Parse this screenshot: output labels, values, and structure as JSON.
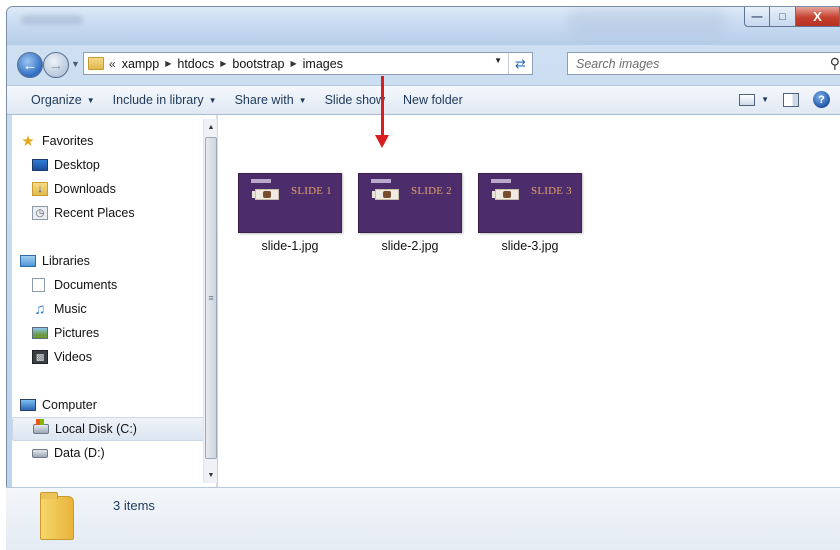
{
  "window": {
    "caption_buttons": {
      "minimize_icon": "minimize-icon",
      "maximize_icon": "maximize-icon",
      "close_label": "X"
    }
  },
  "address": {
    "overflow": "«",
    "crumbs": [
      "xampp",
      "htdocs",
      "bootstrap",
      "images"
    ],
    "refresh_icon": "refresh-icon"
  },
  "search": {
    "placeholder": "Search images"
  },
  "toolbar": {
    "organize": "Organize",
    "include_in_library": "Include in library",
    "share_with": "Share with",
    "slide_show": "Slide show",
    "new_folder": "New folder"
  },
  "sidebar": {
    "favorites": {
      "label": "Favorites",
      "items": [
        "Desktop",
        "Downloads",
        "Recent Places"
      ]
    },
    "libraries": {
      "label": "Libraries",
      "items": [
        "Documents",
        "Music",
        "Pictures",
        "Videos"
      ]
    },
    "computer": {
      "label": "Computer",
      "items": [
        "Local Disk (C:)",
        "Data (D:)"
      ],
      "selected": "Local Disk (C:)"
    }
  },
  "files": [
    {
      "name": "slide-1.jpg",
      "thumb_text": "SLIDE 1"
    },
    {
      "name": "slide-2.jpg",
      "thumb_text": "SLIDE 2"
    },
    {
      "name": "slide-3.jpg",
      "thumb_text": "SLIDE 3"
    }
  ],
  "status": {
    "item_count": "3 items"
  },
  "colors": {
    "annotation_arrow": "#d81e1e",
    "thumb_bg": "#4c2c6a",
    "thumb_text": "#e0a26a"
  }
}
